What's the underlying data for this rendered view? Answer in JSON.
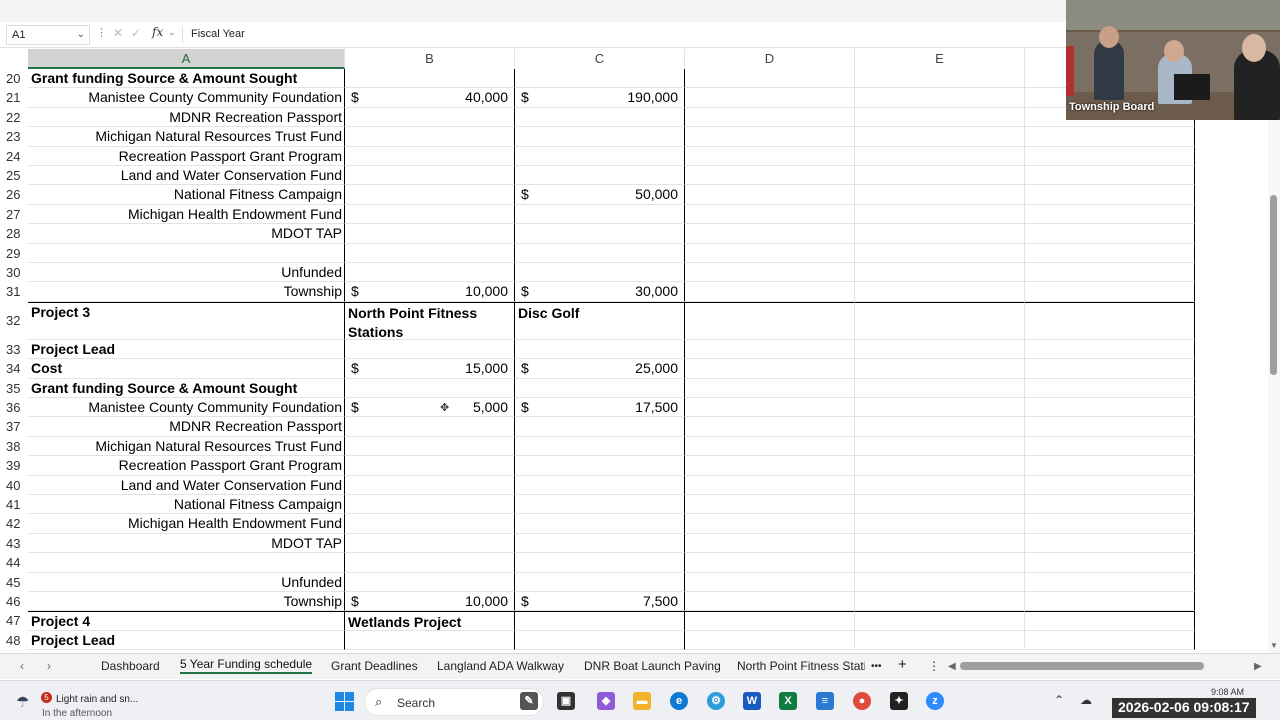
{
  "formula_bar": {
    "cell_ref": "A1",
    "content": "Fiscal Year",
    "fx": "fx"
  },
  "columns": [
    "A",
    "B",
    "C",
    "D",
    "E"
  ],
  "rows": [
    {
      "n": "20",
      "a": "Grant funding Source & Amount Sought",
      "a_style": "bold",
      "b": "",
      "c": ""
    },
    {
      "n": "21",
      "a": "Manistee County Community Foundation",
      "a_style": "right",
      "b_dollar": "$",
      "b_amt": "40,000",
      "c_dollar": "$",
      "c_amt": "190,000"
    },
    {
      "n": "22",
      "a": "MDNR Recreation Passport",
      "a_style": "right"
    },
    {
      "n": "23",
      "a": "Michigan Natural Resources Trust Fund",
      "a_style": "right"
    },
    {
      "n": "24",
      "a": "Recreation Passport Grant Program",
      "a_style": "right"
    },
    {
      "n": "25",
      "a": "Land and Water Conservation Fund",
      "a_style": "right"
    },
    {
      "n": "26",
      "a": "National Fitness Campaign",
      "a_style": "right",
      "c_dollar": "$",
      "c_amt": "50,000"
    },
    {
      "n": "27",
      "a": "Michigan Health Endowment Fund",
      "a_style": "right"
    },
    {
      "n": "28",
      "a": "MDOT TAP",
      "a_style": "right"
    },
    {
      "n": "29",
      "a": "",
      "a_style": "right"
    },
    {
      "n": "30",
      "a": "Unfunded",
      "a_style": "right"
    },
    {
      "n": "31",
      "a": "Township",
      "a_style": "right",
      "b_dollar": "$",
      "b_amt": "10,000",
      "c_dollar": "$",
      "c_amt": "30,000"
    },
    {
      "n": "32",
      "a": "Project 3",
      "a_style": "bold",
      "b_text": "North Point Fitness Stations",
      "c_text": "Disc Golf",
      "tall": true
    },
    {
      "n": "33",
      "a": "Project Lead",
      "a_style": "bold"
    },
    {
      "n": "34",
      "a": "Cost",
      "a_style": "bold",
      "b_dollar": "$",
      "b_amt": "15,000",
      "c_dollar": "$",
      "c_amt": "25,000"
    },
    {
      "n": "35",
      "a": "Grant funding Source & Amount Sought",
      "a_style": "bold"
    },
    {
      "n": "36",
      "a": "Manistee County Community Foundation",
      "a_style": "right",
      "b_dollar": "$",
      "b_amt": "5,000",
      "c_dollar": "$",
      "c_amt": "17,500"
    },
    {
      "n": "37",
      "a": "MDNR Recreation Passport",
      "a_style": "right"
    },
    {
      "n": "38",
      "a": "Michigan Natural Resources Trust Fund",
      "a_style": "right"
    },
    {
      "n": "39",
      "a": "Recreation Passport Grant Program",
      "a_style": "right"
    },
    {
      "n": "40",
      "a": "Land and Water Conservation Fund",
      "a_style": "right"
    },
    {
      "n": "41",
      "a": "National Fitness Campaign",
      "a_style": "right"
    },
    {
      "n": "42",
      "a": "Michigan Health Endowment Fund",
      "a_style": "right"
    },
    {
      "n": "43",
      "a": "MDOT TAP",
      "a_style": "right"
    },
    {
      "n": "44",
      "a": "",
      "a_style": "right"
    },
    {
      "n": "45",
      "a": "Unfunded",
      "a_style": "right"
    },
    {
      "n": "46",
      "a": "Township",
      "a_style": "right",
      "b_dollar": "$",
      "b_amt": "10,000",
      "c_dollar": "$",
      "c_amt": "7,500"
    },
    {
      "n": "47",
      "a": "Project 4",
      "a_style": "bold",
      "b_text": "Wetlands Project"
    },
    {
      "n": "48",
      "a": "Project Lead",
      "a_style": "bold"
    }
  ],
  "sheet_tabs": {
    "items": [
      "Dashboard",
      "5 Year Funding schedule",
      "Grant Deadlines",
      "Langland ADA Walkway",
      "DNR Boat Launch Paving",
      "North Point Fitness Static"
    ],
    "active": "5 Year Funding schedule",
    "more": "•••",
    "add": "+",
    "menu": "⋮"
  },
  "video": {
    "label": "Township Board"
  },
  "taskbar": {
    "weather_title": "Light rain and sn...",
    "weather_sub": "In the afternoon",
    "weather_badge": "5",
    "search_placeholder": "Search",
    "clock_time": "9:08 AM",
    "stamp": "2026-02-06 09:08:17"
  }
}
